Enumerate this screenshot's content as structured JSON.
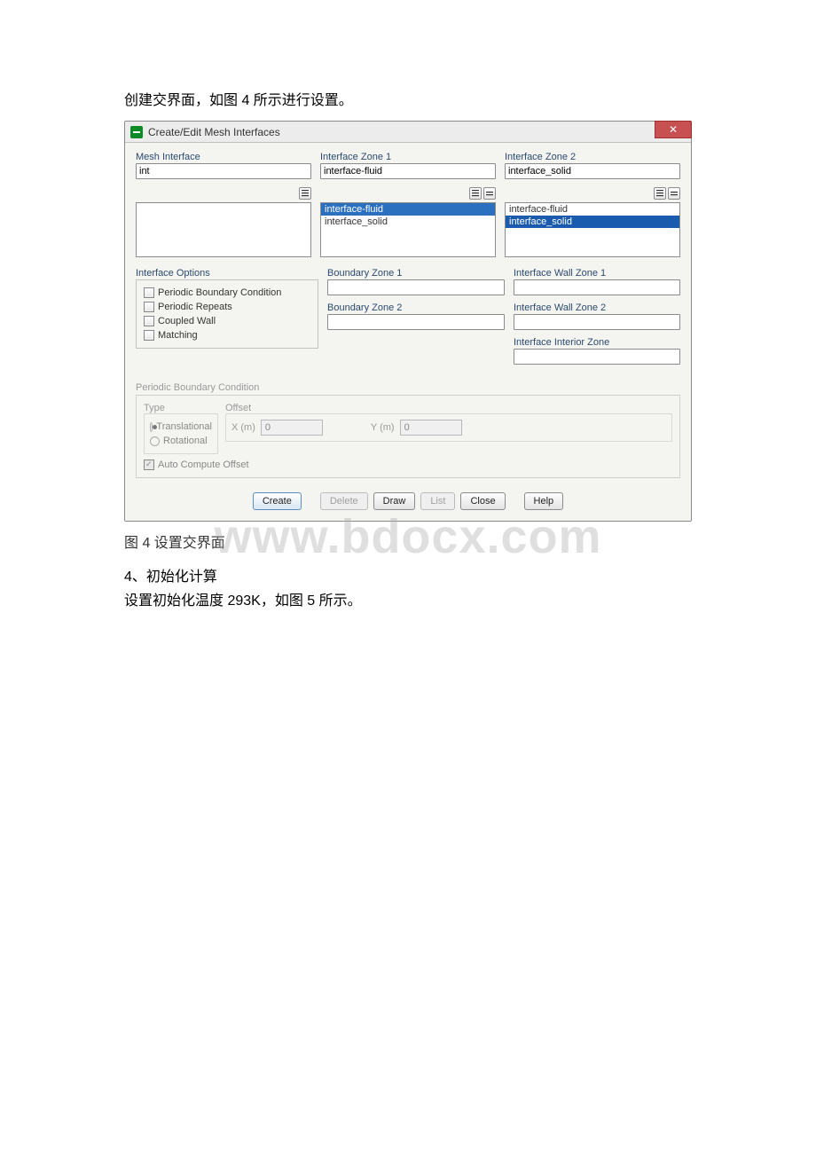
{
  "intro": "创建交界面，如图 4 所示进行设置。",
  "window": {
    "title": "Create/Edit Mesh Interfaces",
    "close": "✕",
    "mesh_interface_label": "Mesh Interface",
    "mesh_interface_value": "int",
    "zone1_label": "Interface Zone 1",
    "zone1_value": "interface-fluid",
    "zone1_list": [
      "interface-fluid",
      "interface_solid"
    ],
    "zone1_selected": 0,
    "zone2_label": "Interface Zone 2",
    "zone2_value": "interface_solid",
    "zone2_list": [
      "interface-fluid",
      "interface_solid"
    ],
    "zone2_selected": 1,
    "options_label": "Interface Options",
    "options": {
      "periodic": "Periodic Boundary Condition",
      "repeats": "Periodic Repeats",
      "coupled": "Coupled Wall",
      "matching": "Matching"
    },
    "boundary1_label": "Boundary Zone 1",
    "boundary2_label": "Boundary Zone 2",
    "wall1_label": "Interface Wall Zone 1",
    "wall2_label": "Interface Wall Zone 2",
    "interior_label": "Interface Interior Zone",
    "pbc_label": "Periodic Boundary Condition",
    "type_label": "Type",
    "offset_label": "Offset",
    "translational": "Translational",
    "rotational": "Rotational",
    "xm_label": "X (m)",
    "ym_label": "Y (m)",
    "xm_value": "0",
    "ym_value": "0",
    "auto_compute": "Auto Compute Offset",
    "buttons": {
      "create": "Create",
      "delete": "Delete",
      "draw": "Draw",
      "list": "List",
      "close": "Close",
      "help": "Help"
    }
  },
  "caption": "图 4 设置交界面",
  "section4": "4、初始化计算",
  "init_text": "设置初始化温度 293K，如图 5 所示。",
  "watermark": "www.bdocx.com"
}
